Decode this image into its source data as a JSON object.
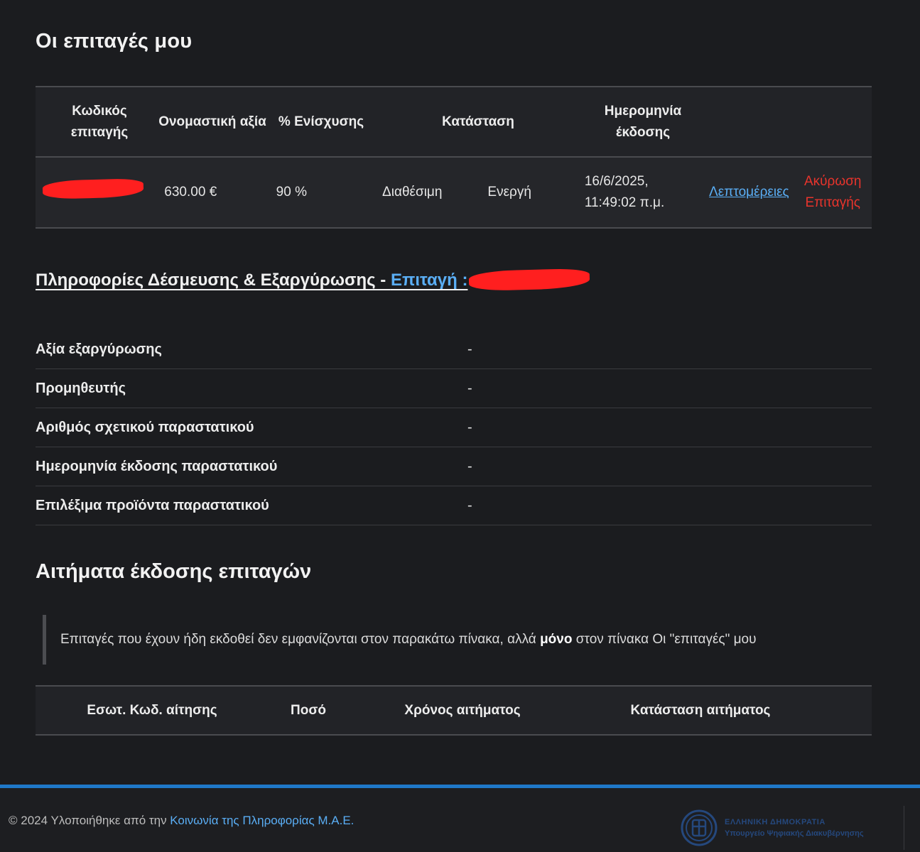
{
  "page": {
    "title": "Οι επιταγές μου"
  },
  "vouchers": {
    "headers": {
      "code": "Κωδικός επιταγής",
      "nominal": "Ονομαστική αξία",
      "percent": "% Ενίσχυσης",
      "status": "Κατάσταση",
      "issue_date": "Ημερομηνία έκδοσης"
    },
    "rows": [
      {
        "nominal": "630.00 €",
        "percent": "90 %",
        "availability": "Διαθέσιμη",
        "state": "Ενεργή",
        "date": "16/6/2025,",
        "time": "11:49:02 π.μ.",
        "details_link": "Λεπτομέρειες",
        "cancel_1": "Ακύρωση",
        "cancel_2": "Επιταγής"
      }
    ]
  },
  "info": {
    "heading": "Πληροφορίες Δέσμευσης & Εξαργύρωσης - ",
    "heading_accent": "Επιταγή :",
    "rows": [
      {
        "label": "Αξία εξαργύρωσης",
        "value": "-"
      },
      {
        "label": "Προμηθευτής",
        "value": "-"
      },
      {
        "label": "Αριθμός σχετικού παραστατικού",
        "value": "-"
      },
      {
        "label": "Ημερομηνία έκδοσης παραστατικού",
        "value": "-"
      },
      {
        "label": "Επιλέξιμα προϊόντα παραστατικού",
        "value": "-"
      }
    ]
  },
  "requests": {
    "title": "Αιτήματα έκδοσης επιταγών",
    "note_pre": "Επιταγές που έχουν ήδη εκδοθεί δεν εμφανίζονται στον παρακάτω πίνακα, αλλά ",
    "note_bold": "μόνο",
    "note_post": " στον πίνακα Οι \"επιταγές\" μου",
    "headers": {
      "internal_code": "Εσωτ. Κωδ. αίτησης",
      "amount": "Ποσό",
      "time": "Χρόνος αιτήματος",
      "status": "Κατάσταση αιτήματος"
    }
  },
  "footer": {
    "copy": "© 2024 Υλοποιήθηκε από την ",
    "link": "Κοινωνία της Πληροφορίας Μ.Α.Ε.",
    "logo_line1": "ΕΛΛΗΝΙΚΗ ΔΗΜΟΚΡΑΤΙΑ",
    "logo_line2": "Υπουργείο Ψηφιακής Διακυβέρνησης",
    "logo_icon": "hellenic-republic-emblem"
  },
  "colors": {
    "accent": "#5aaef5",
    "danger": "#e8342c",
    "redaction": "#ff1f1f",
    "footer_bar": "#1f78c8"
  }
}
